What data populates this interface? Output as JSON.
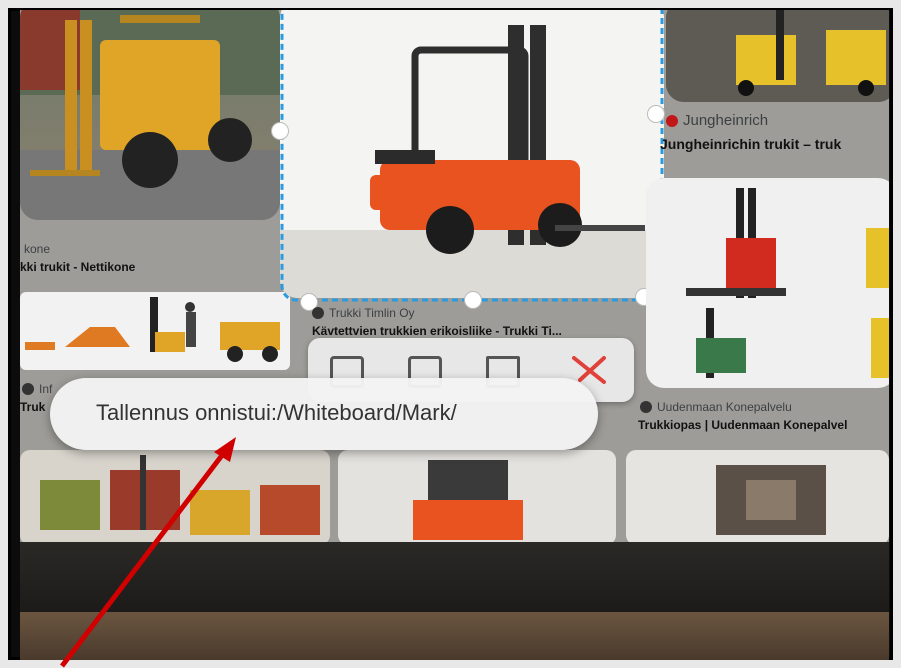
{
  "left_column": {
    "card1_source": "kone",
    "card1_title": "kki trukit - Nettikone",
    "card3_source_partial": "Inf",
    "card3_title_partial": "Truk"
  },
  "selected_card": {
    "source": "Trukki Timlin Oy",
    "title": "Kävtettvien trukkien erikoisliike - Trukki Ti..."
  },
  "right_column": {
    "card1_source": "Jungheinrich",
    "card1_title": "Jungheinrichin trukit – truk",
    "card2_source": "Uudenmaan Konepalvelu",
    "card2_title": "Trukkiopas | Uudenmaan Konepalvel"
  },
  "toolbar": {
    "icons": [
      "image-icon",
      "save-icon",
      "share-icon",
      "close-icon"
    ]
  },
  "toast": {
    "message": "Tallennus onnistui:/Whiteboard/Mark/"
  },
  "colors": {
    "selection_border": "#2b9be0",
    "close_x": "#e0413a",
    "arrow": "#d10000",
    "forklift_orange": "#e8531f",
    "forklift_yellow": "#e0a526"
  }
}
